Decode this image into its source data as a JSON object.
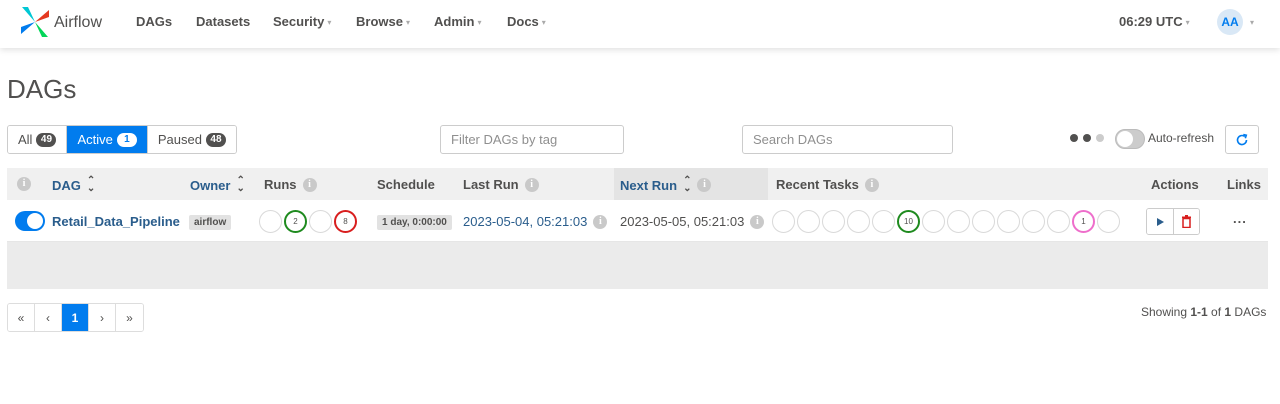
{
  "navbar": {
    "brand": "Airflow",
    "items": [
      {
        "label": "DAGs",
        "dropdown": false
      },
      {
        "label": "Datasets",
        "dropdown": false
      },
      {
        "label": "Security",
        "dropdown": true
      },
      {
        "label": "Browse",
        "dropdown": true
      },
      {
        "label": "Admin",
        "dropdown": true
      },
      {
        "label": "Docs",
        "dropdown": true
      }
    ],
    "clock": "06:29 UTC",
    "avatar_initials": "AA"
  },
  "page": {
    "title": "DAGs"
  },
  "filters": {
    "tabs": [
      {
        "label": "All",
        "count": "49"
      },
      {
        "label": "Active",
        "count": "1"
      },
      {
        "label": "Paused",
        "count": "48"
      }
    ],
    "active_tab": "Active",
    "tag_filter_placeholder": "Filter DAGs by tag",
    "search_placeholder": "Search DAGs",
    "autorefresh_label": "Auto-refresh"
  },
  "table": {
    "headers": {
      "dag": "DAG",
      "owner": "Owner",
      "runs": "Runs",
      "schedule": "Schedule",
      "last_run": "Last Run",
      "next_run": "Next Run",
      "recent_tasks": "Recent Tasks",
      "actions": "Actions",
      "links": "Links"
    },
    "rows": [
      {
        "dag_id": "Retail_Data_Pipeline",
        "active": true,
        "owner": "airflow",
        "runs": [
          "",
          "2",
          "",
          "8"
        ],
        "schedule": "1 day, 0:00:00",
        "last_run": "2023-05-04, 05:21:03",
        "next_run": "2023-05-05, 05:21:03",
        "recent_tasks": [
          "",
          "",
          "",
          "",
          "",
          "10",
          "",
          "",
          "",
          "",
          "",
          "",
          "1",
          ""
        ],
        "links": "..."
      }
    ]
  },
  "pagination": {
    "pages": [
      "«",
      "‹",
      "1",
      "›",
      "»"
    ],
    "current": "1",
    "showing_prefix": "Showing ",
    "range": "1-1",
    "of": " of ",
    "total": "1",
    "suffix": " DAGs"
  },
  "colors": {
    "accent": "#017cee",
    "link": "#2a5d8c",
    "success": "#1e8a1e",
    "failed": "#d81e1e",
    "up_for_retry": "#ee6ecb"
  }
}
